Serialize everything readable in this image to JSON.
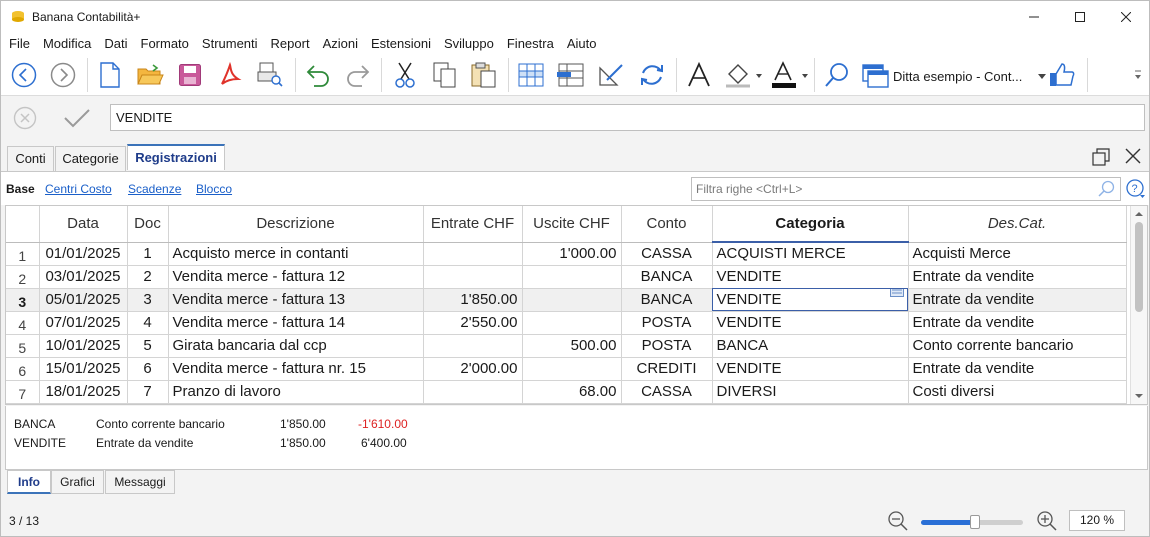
{
  "app": {
    "title": "Banana Contabilità+"
  },
  "menu": [
    "File",
    "Modifica",
    "Dati",
    "Formato",
    "Strumenti",
    "Report",
    "Azioni",
    "Estensioni",
    "Sviluppo",
    "Finestra",
    "Aiuto"
  ],
  "toolbar": {
    "file_label": "Ditta esempio - Cont..."
  },
  "editbar": {
    "value": "VENDITE"
  },
  "tabs": [
    "Conti",
    "Categorie",
    "Registrazioni"
  ],
  "active_tab": "Registrazioni",
  "views": [
    "Base",
    "Centri Costo",
    "Scadenze",
    "Blocco"
  ],
  "filter": {
    "placeholder": "Filtra righe <Ctrl+L>"
  },
  "table": {
    "columns": [
      "Data",
      "Doc",
      "Descrizione",
      "Entrate CHF",
      "Uscite CHF",
      "Conto",
      "Categoria",
      "Des.Cat."
    ],
    "rows": [
      {
        "n": "1",
        "data": "01/01/2025",
        "doc": "1",
        "desc": "Acquisto merce in contanti",
        "entrate": "",
        "uscite": "1'000.00",
        "conto": "CASSA",
        "cat": "ACQUISTI MERCE",
        "descat": "Acquisti Merce"
      },
      {
        "n": "2",
        "data": "03/01/2025",
        "doc": "2",
        "desc": "Vendita merce - fattura 12",
        "entrate": "",
        "uscite": "",
        "conto": "BANCA",
        "cat": "VENDITE",
        "descat": "Entrate da vendite"
      },
      {
        "n": "3",
        "data": "05/01/2025",
        "doc": "3",
        "desc": "Vendita merce - fattura 13",
        "entrate": "1'850.00",
        "uscite": "",
        "conto": "BANCA",
        "cat": "VENDITE",
        "descat": "Entrate da vendite"
      },
      {
        "n": "4",
        "data": "07/01/2025",
        "doc": "4",
        "desc": "Vendita merce - fattura 14",
        "entrate": "2'550.00",
        "uscite": "",
        "conto": "POSTA",
        "cat": "VENDITE",
        "descat": "Entrate da vendite"
      },
      {
        "n": "5",
        "data": "10/01/2025",
        "doc": "5",
        "desc": "Girata bancaria dal ccp",
        "entrate": "",
        "uscite": "500.00",
        "conto": "POSTA",
        "cat": "BANCA",
        "descat": "Conto corrente bancario"
      },
      {
        "n": "6",
        "data": "15/01/2025",
        "doc": "6",
        "desc": "Vendita merce - fattura nr. 15",
        "entrate": "2'000.00",
        "uscite": "",
        "conto": "CREDITI",
        "cat": "VENDITE",
        "descat": "Entrate da vendite"
      },
      {
        "n": "7",
        "data": "18/01/2025",
        "doc": "7",
        "desc": "Pranzo di lavoro",
        "entrate": "",
        "uscite": "68.00",
        "conto": "CASSA",
        "cat": "DIVERSI",
        "descat": "Costi diversi"
      }
    ]
  },
  "info": {
    "rows": [
      {
        "code": "BANCA",
        "desc": "Conto corrente bancario",
        "amount": "1'850.00",
        "balance": "-1'610.00"
      },
      {
        "code": "VENDITE",
        "desc": "Entrate da vendite",
        "amount": "1'850.00",
        "balance": "6'400.00"
      }
    ]
  },
  "bottom_tabs": [
    "Info",
    "Grafici",
    "Messaggi"
  ],
  "status": {
    "position": "3 / 13",
    "zoom": "120 %",
    "zoom_level_fraction": 0.53
  }
}
